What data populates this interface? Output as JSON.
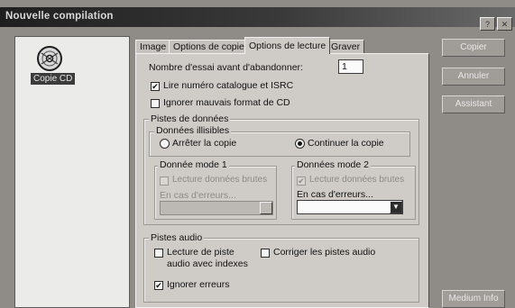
{
  "window": {
    "title": "Nouvelle compilation",
    "help_btn": "?",
    "close_btn": "✕"
  },
  "sidebar": {
    "item_label": "Copie CD",
    "item_icon": "cd-disc-icon"
  },
  "tabs": [
    "Image",
    "Options de copie",
    "Options de lecture",
    "Graver"
  ],
  "active_tab": "Options de lecture",
  "panel": {
    "retry_label": "Nombre d'essai avant d'abandonner:",
    "retry_value": "1",
    "read_catalog": {
      "label": "Lire numéro catalogue et ISRC",
      "checked": true
    },
    "ignore_bad_format": {
      "label": "Ignorer mauvais format de CD",
      "checked": false
    },
    "data_tracks": {
      "title": "Pistes de données",
      "unreadable": {
        "title": "Données illisibles",
        "stop_copy": {
          "label": "Arrêter la copie",
          "selected": false
        },
        "continue_copy": {
          "label": "Continuer la copie",
          "selected": true
        }
      },
      "mode1": {
        "title": "Donnée mode 1",
        "raw_read": {
          "label": "Lecture données brutes",
          "checked": false,
          "disabled": true
        },
        "on_error_label": "En cas d'erreurs...",
        "on_error_value": ""
      },
      "mode2": {
        "title": "Données mode 2",
        "raw_read": {
          "label": "Lecture données brutes",
          "checked": true,
          "disabled": true
        },
        "on_error_label": "En cas d'erreurs...",
        "on_error_value": ""
      }
    },
    "audio_tracks": {
      "title": "Pistes audio",
      "read_index": {
        "label_line1": "Lecture de piste",
        "label_line2": "audio avec indexes",
        "checked": false
      },
      "fix_audio": {
        "label": "Corriger les pistes audio",
        "checked": false
      },
      "ignore_errors": {
        "label": "Ignorer erreurs",
        "checked": true
      }
    }
  },
  "buttons": {
    "copy": "Copier",
    "cancel": "Annuler",
    "wizard": "Assistant",
    "media_info": "Medium Info"
  },
  "colors": {
    "titlebar": "#1f1f1f",
    "panel": "#cfccc7",
    "selection": "#3b3b3b"
  }
}
